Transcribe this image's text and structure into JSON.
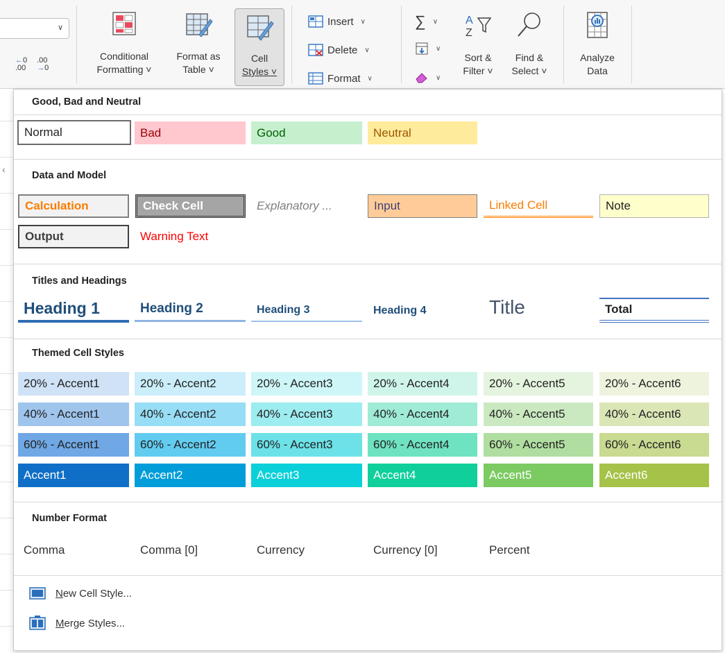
{
  "ribbon": {
    "number_decrease_icon": "decrease-decimal-icon",
    "number_increase_icon": "increase-decimal-icon",
    "conditional_formatting": {
      "line1": "Conditional",
      "line2": "Formatting ˅"
    },
    "format_as_table": {
      "line1": "Format as",
      "line2": "Table ˅"
    },
    "cell_styles": {
      "line1": "Cell",
      "line2": "Styles ˅"
    },
    "insert_label": "Insert",
    "delete_label": "Delete",
    "format_label": "Format",
    "sort_filter": {
      "line1": "Sort &",
      "line2": "Filter ˅"
    },
    "find_select": {
      "line1": "Find &",
      "line2": "Select ˅"
    },
    "analyze_data": {
      "line1": "Analyze",
      "line2": "Data"
    }
  },
  "panel": {
    "sections": {
      "good_bad_neutral": "Good, Bad and Neutral",
      "data_model": "Data and Model",
      "titles_headings": "Titles and Headings",
      "themed": "Themed Cell Styles",
      "number_format": "Number Format"
    },
    "good_bad_neutral": [
      "Normal",
      "Bad",
      "Good",
      "Neutral"
    ],
    "data_model_row1": [
      "Calculation",
      "Check Cell",
      "Explanatory ...",
      "Input",
      "Linked Cell",
      "Note"
    ],
    "data_model_row2": [
      "Output",
      "Warning Text"
    ],
    "titles": [
      "Heading 1",
      "Heading 2",
      "Heading 3",
      "Heading 4",
      "Title",
      "Total"
    ],
    "themed_20": [
      "20% - Accent1",
      "20% - Accent2",
      "20% - Accent3",
      "20% - Accent4",
      "20% - Accent5",
      "20% - Accent6"
    ],
    "themed_40": [
      "40% - Accent1",
      "40% - Accent2",
      "40% - Accent3",
      "40% - Accent4",
      "40% - Accent5",
      "40% - Accent6"
    ],
    "themed_60": [
      "60% - Accent1",
      "60% - Accent2",
      "60% - Accent3",
      "60% - Accent4",
      "60% - Accent5",
      "60% - Accent6"
    ],
    "themed_100": [
      "Accent1",
      "Accent2",
      "Accent3",
      "Accent4",
      "Accent5",
      "Accent6"
    ],
    "number_formats": [
      "Comma",
      "Comma [0]",
      "Currency",
      "Currency [0]",
      "Percent"
    ],
    "new_cell_style": {
      "accel": "N",
      "rest": "ew Cell Style..."
    },
    "merge_styles": {
      "accel": "M",
      "rest": "erge Styles..."
    }
  },
  "colors": {
    "bad_bg": "#ffc7ce",
    "bad_fg": "#9c0006",
    "good_bg": "#c6efce",
    "good_fg": "#006100",
    "neutral_bg": "#ffeb9c",
    "neutral_fg": "#9c5700",
    "accent1": "#0f6fc6",
    "accent2": "#009dd9",
    "accent3": "#0bd0d9",
    "accent4": "#10cf9b",
    "accent5": "#7cca62",
    "accent6": "#a5c249"
  }
}
